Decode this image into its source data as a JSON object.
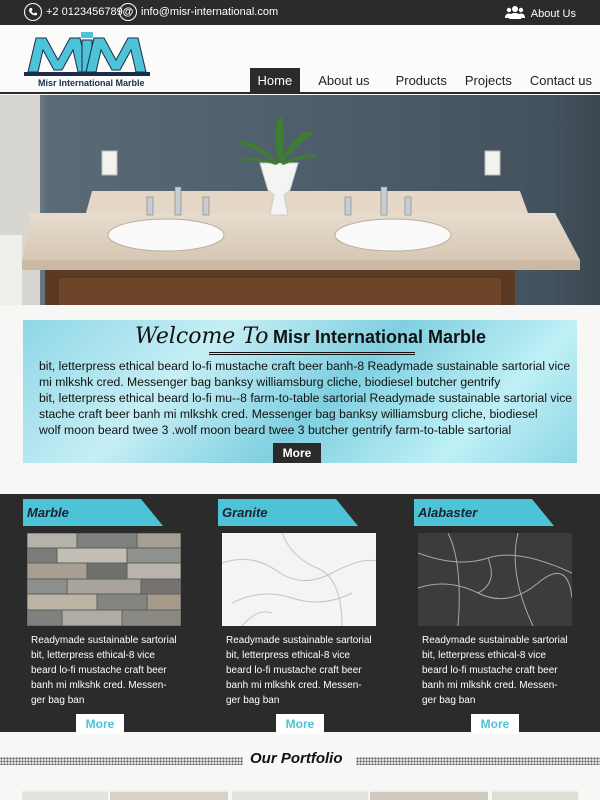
{
  "topbar": {
    "phone": "+2 0123456789",
    "email": "info@misr-international.com",
    "about": "About Us",
    "icons": [
      "phone-icon",
      "at-icon",
      "users-icon"
    ]
  },
  "brand": {
    "logo_letters": "MIM",
    "name": "Misr International Marble",
    "accent": "#4cc3d6"
  },
  "nav": {
    "home": "Home",
    "about": "About us",
    "products": "Products",
    "projects": "Projects",
    "contact": "Contact us"
  },
  "welcome": {
    "title_script": "Welcome To",
    "title_bold": "Misr International Marble",
    "lines": [
      "bit, letterpress ethical beard lo-fi mustache craft beer banh-8 Readymade sustainable sartorial vice",
      "mi mlkshk cred. Messenger bag banksy williamsburg cliche, biodiesel butcher gentrify",
      "bit, letterpress ethical beard lo-fi mu--8 farm-to-table sartorial Readymade sustainable sartorial vice",
      "stache craft beer banh mi mlkshk cred. Messenger bag banksy williamsburg cliche, biodiesel",
      "wolf moon beard twee 3  .wolf moon beard twee 3 butcher gentrify farm-to-table sartorial"
    ],
    "more": "More"
  },
  "products": [
    {
      "label": "Marble",
      "lines": [
        "Readymade sustainable sartorial",
        "bit, letterpress ethical-8 vice",
        "beard lo-fi mustache craft beer",
        "banh mi mlkshk cred. Messen-",
        "ger bag ban"
      ],
      "more": "More"
    },
    {
      "label": "Granite",
      "lines": [
        "Readymade sustainable sartorial",
        "bit, letterpress ethical-8 vice",
        "beard lo-fi mustache craft beer",
        "banh mi mlkshk cred. Messen-",
        "ger bag ban"
      ],
      "more": "More"
    },
    {
      "label": "Alabaster",
      "lines": [
        "Readymade sustainable sartorial",
        "bit, letterpress ethical-8 vice",
        "beard lo-fi mustache craft beer",
        "banh mi mlkshk cred. Messen-",
        "ger bag ban"
      ],
      "more": "More"
    }
  ],
  "portfolio": {
    "title": "Our Portfolio"
  }
}
